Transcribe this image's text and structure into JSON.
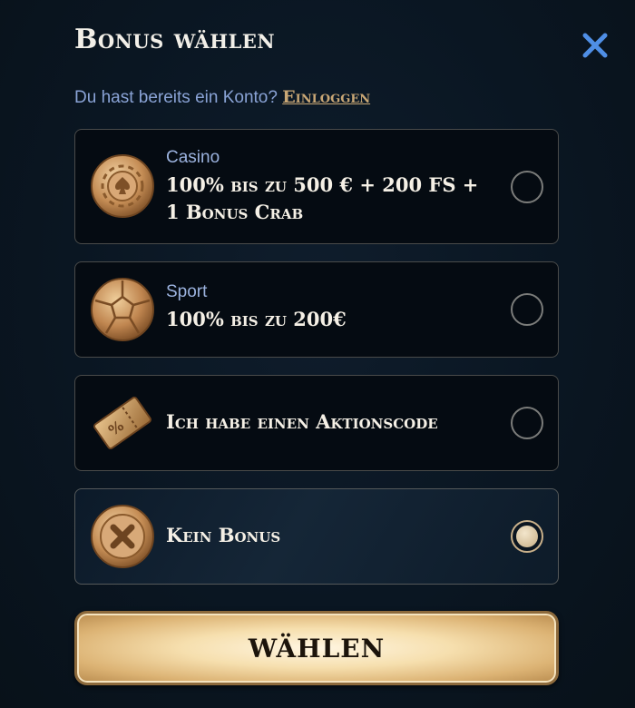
{
  "header": {
    "title": "Bonus wählen",
    "close_icon": "close-icon"
  },
  "subtitle": {
    "text": "Du hast bereits ein Konto? ",
    "login_label": "Einloggen"
  },
  "options": [
    {
      "icon": "casino-chip-icon",
      "category": "Casino",
      "offer_line1": "100% bis zu 500 € + 200 FS +",
      "offer_line2": "1 Bonus Crab",
      "selected": false
    },
    {
      "icon": "soccer-ball-icon",
      "category": "Sport",
      "offer_line1": "100% bis zu 200€",
      "selected": false
    },
    {
      "icon": "promo-ticket-icon",
      "offer_line1": "Ich habe einen Aktionscode",
      "selected": false
    },
    {
      "icon": "no-bonus-icon",
      "offer_line1": "Kein Bonus",
      "selected": true
    }
  ],
  "submit": {
    "label": "WÄHLEN"
  },
  "colors": {
    "accent_gold": "#c9a775",
    "link_blue": "#8aa3d6",
    "close_blue": "#4f8fe6",
    "background": "#0a1622"
  }
}
